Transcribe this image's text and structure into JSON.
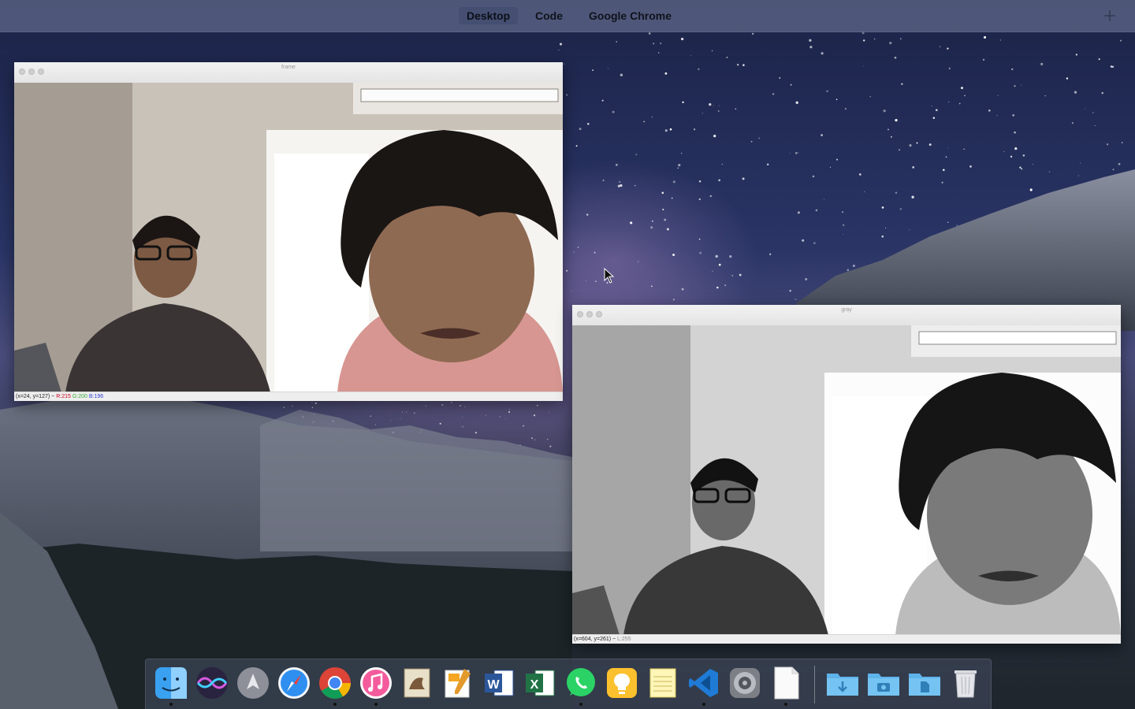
{
  "mission_control": {
    "spaces": [
      {
        "label": "Desktop"
      },
      {
        "label": "Code"
      },
      {
        "label": "Google Chrome"
      }
    ]
  },
  "windows": [
    {
      "title": "frame",
      "status": {
        "coords": "(x=24, y=127) ~",
        "r": "R:215",
        "g": "G:200",
        "b": "B:196"
      }
    },
    {
      "title": "gray",
      "status": {
        "coords": "(x=604, y=261) ~",
        "l": "L:255"
      }
    }
  ],
  "dock": {
    "apps": [
      {
        "icon": "finder-icon",
        "running": true
      },
      {
        "icon": "siri-icon",
        "running": false
      },
      {
        "icon": "launchpad-icon",
        "running": false
      },
      {
        "icon": "safari-icon",
        "running": false
      },
      {
        "icon": "chrome-icon",
        "running": true
      },
      {
        "icon": "itunes-icon",
        "running": true
      },
      {
        "icon": "preview-icon",
        "running": false
      },
      {
        "icon": "pages-icon",
        "running": false
      },
      {
        "icon": "word-icon",
        "running": false
      },
      {
        "icon": "excel-icon",
        "running": false
      },
      {
        "icon": "whatsapp-icon",
        "running": true
      },
      {
        "icon": "tips-icon",
        "running": false
      },
      {
        "icon": "notes-icon",
        "running": false
      },
      {
        "icon": "vscode-icon",
        "running": true
      },
      {
        "icon": "system-preferences-icon",
        "running": false
      },
      {
        "icon": "document-icon",
        "running": true
      }
    ],
    "stacks": [
      {
        "icon": "downloads-folder-icon"
      },
      {
        "icon": "screenshots-folder-icon"
      },
      {
        "icon": "documents-folder-icon"
      },
      {
        "icon": "trash-icon"
      }
    ]
  }
}
